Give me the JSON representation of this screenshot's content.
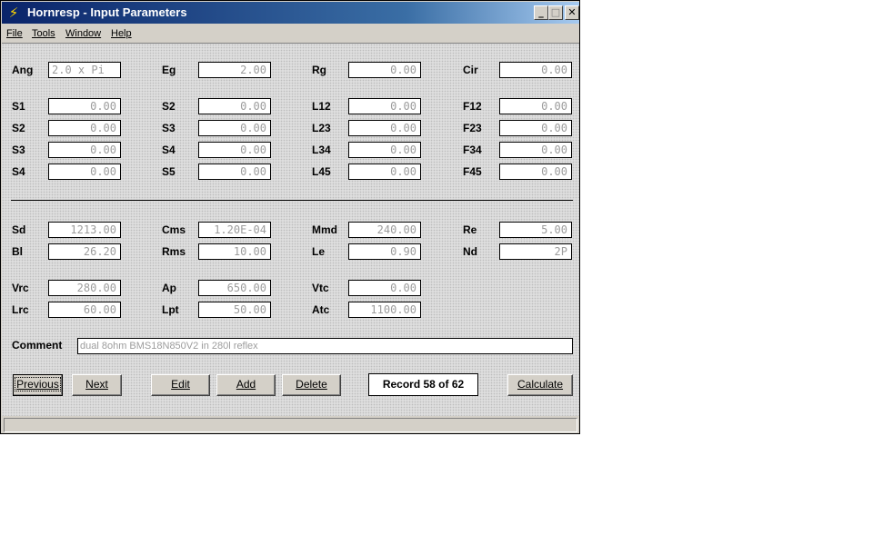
{
  "window": {
    "title": "Hornresp - Input Parameters"
  },
  "menu": [
    "File",
    "Tools",
    "Window",
    "Help"
  ],
  "rows": [
    [
      {
        "label": "Ang",
        "value": "2.0 x Pi"
      },
      {
        "label": "Eg",
        "value": "2.00"
      },
      {
        "label": "Rg",
        "value": "0.00"
      },
      {
        "label": "Cir",
        "value": "0.00"
      }
    ],
    [
      {
        "label": "S1",
        "value": "0.00"
      },
      {
        "label": "S2",
        "value": "0.00"
      },
      {
        "label": "L12",
        "value": "0.00"
      },
      {
        "label": "F12",
        "value": "0.00"
      }
    ],
    [
      {
        "label": "S2",
        "value": "0.00"
      },
      {
        "label": "S3",
        "value": "0.00"
      },
      {
        "label": "L23",
        "value": "0.00"
      },
      {
        "label": "F23",
        "value": "0.00"
      }
    ],
    [
      {
        "label": "S3",
        "value": "0.00"
      },
      {
        "label": "S4",
        "value": "0.00"
      },
      {
        "label": "L34",
        "value": "0.00"
      },
      {
        "label": "F34",
        "value": "0.00"
      }
    ],
    [
      {
        "label": "S4",
        "value": "0.00"
      },
      {
        "label": "S5",
        "value": "0.00"
      },
      {
        "label": "L45",
        "value": "0.00"
      },
      {
        "label": "F45",
        "value": "0.00"
      }
    ],
    [
      {
        "label": "Sd",
        "value": "1213.00"
      },
      {
        "label": "Cms",
        "value": "1.20E-04"
      },
      {
        "label": "Mmd",
        "value": "240.00"
      },
      {
        "label": "Re",
        "value": "5.00"
      }
    ],
    [
      {
        "label": "Bl",
        "value": "26.20"
      },
      {
        "label": "Rms",
        "value": "10.00"
      },
      {
        "label": "Le",
        "value": "0.90"
      },
      {
        "label": "Nd",
        "value": "2P"
      }
    ],
    [
      {
        "label": "Vrc",
        "value": "280.00"
      },
      {
        "label": "Ap",
        "value": "650.00"
      },
      {
        "label": "Vtc",
        "value": "0.00"
      }
    ],
    [
      {
        "label": "Lrc",
        "value": "60.00"
      },
      {
        "label": "Lpt",
        "value": "50.00"
      },
      {
        "label": "Atc",
        "value": "1100.00"
      }
    ]
  ],
  "comment": {
    "label": "Comment",
    "value": "dual 8ohm BMS18N850V2 in 280l reflex"
  },
  "buttons": {
    "previous": "Previous",
    "next": "Next",
    "edit": "Edit",
    "add": "Add",
    "delete": "Delete",
    "calculate": "Calculate"
  },
  "record": "Record 58 of 62",
  "colors": {
    "title_bar": "#0a246a",
    "field_text": "#9c9c9c",
    "face": "#d4d0c8"
  }
}
